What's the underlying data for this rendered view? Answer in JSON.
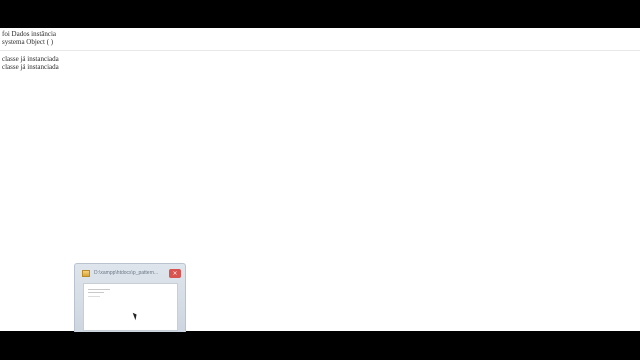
{
  "page": {
    "lines": [
      "foi Dados instância",
      "systema Object ( )",
      "classe já instanciada",
      "classe já instanciada"
    ]
  },
  "taskbar_preview": {
    "title": "D:\\xampp\\htdocs\\p_pattern...",
    "close_symbol": "×",
    "icon": "folder-icon"
  },
  "colors": {
    "background": "#000000",
    "page": "#ffffff",
    "text": "#2a2a2a",
    "close": "#d9534f"
  }
}
